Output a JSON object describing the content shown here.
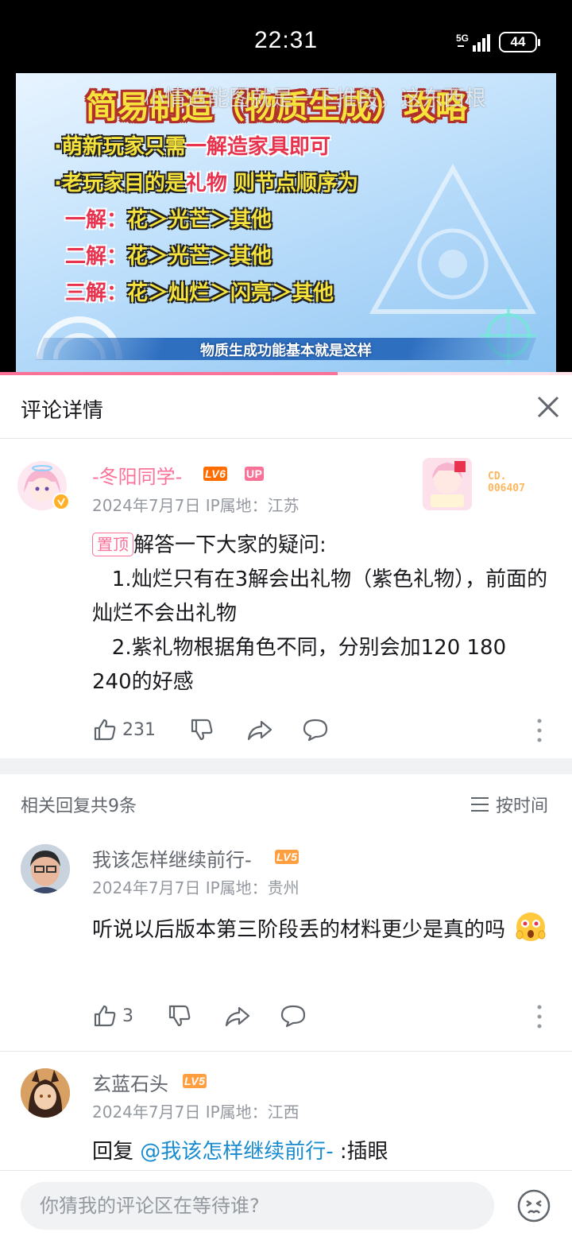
{
  "status_bar": {
    "time": "22:31",
    "network": "5G",
    "battery": "44"
  },
  "video": {
    "title": "简易制造（物质生成）攻略",
    "danmaku": "小情造能图就是一下推段，这东西根",
    "lines": [
      {
        "y1": "·萌新玩家只需",
        "r1": "一解造家具即可",
        "y2": ""
      },
      {
        "y1": "·老玩家目的是",
        "r1": "礼物",
        "y2": " 则节点顺序为"
      },
      {
        "r1": "一解：",
        "y1": "花＞光芒＞其他"
      },
      {
        "r1": "二解：",
        "y1": "花＞光芒＞其他"
      },
      {
        "r1": "三解：",
        "y1": "花＞灿烂＞闪亮＞其他"
      }
    ],
    "subtitle": "物质生成功能基本就是这样",
    "progress": 0.59
  },
  "header": {
    "title": "评论详情"
  },
  "main_comment": {
    "username": "-冬阳同学-",
    "level": "LV6",
    "up_badge": "UP",
    "date": "2024年7月7日",
    "ip_label": "IP属地：江苏",
    "fan_badge_number": "CD.\n006407",
    "pinned_label": "置顶",
    "text_line1": "解答一下大家的疑问:",
    "text_rest": "   1.灿烂只有在3解会出礼物（紫色礼物），前面的灿烂不会出礼物\n   2.紫礼物根据角色不同，分别会加120 180  240的好感",
    "likes": "231"
  },
  "replies_section": {
    "title": "相关回复共9条",
    "sort_label": "按时间"
  },
  "replies": [
    {
      "username": "我该怎样继续前行-",
      "level": "LV5",
      "date": "2024年7月7日",
      "ip_label": "IP属地：贵州",
      "text": "听说以后版本第三阶段丢的材料更少是真的吗",
      "likes": "3"
    },
    {
      "username": "玄蓝石头",
      "level": "LV5",
      "date": "2024年7月7日",
      "ip_label": "IP属地：江西",
      "reply_prefix": "回复 ",
      "mention": "@我该怎样继续前行-",
      "text": " :插眼"
    }
  ],
  "input": {
    "placeholder": "你猜我的评论区在等待谁?"
  },
  "colors": {
    "accent_pink": "#fb7299",
    "lv6": "#ff6c00",
    "lv5": "#ff9f40",
    "link_blue": "#178bcf",
    "muted": "#9499a0"
  }
}
